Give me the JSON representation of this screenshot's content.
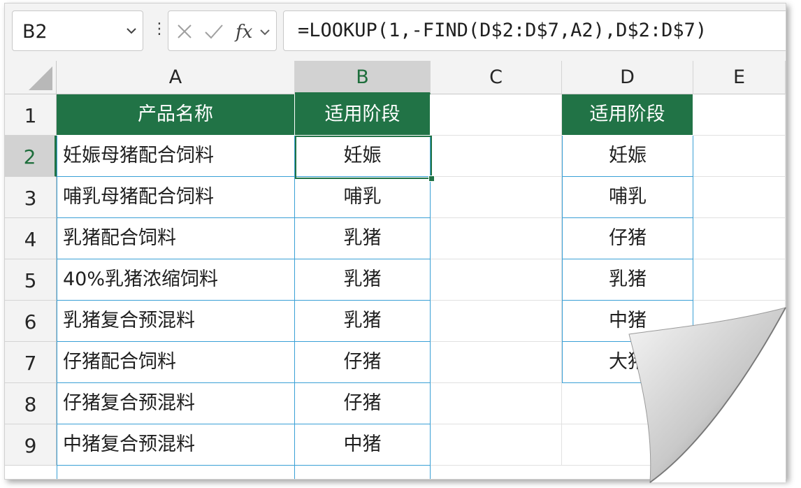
{
  "name_box": {
    "value": "B2"
  },
  "formula_bar": {
    "formula": "=LOOKUP(1,-FIND(D$2:D$7,A2),D$2:D$7)",
    "icons": [
      "cancel-icon",
      "confirm-icon",
      "fx-icon",
      "chevron-down-icon"
    ]
  },
  "columns": [
    "A",
    "B",
    "C",
    "D",
    "E"
  ],
  "rows": [
    "1",
    "2",
    "3",
    "4",
    "5",
    "6",
    "7",
    "8",
    "9"
  ],
  "selected": {
    "column": "B",
    "row": "2"
  },
  "colors": {
    "header_green": "#217346",
    "border_blue": "#3aa0d6",
    "selection_green": "#217346"
  },
  "sheet": {
    "header_a": "产品名称",
    "header_b": "适用阶段",
    "header_d": "适用阶段",
    "col_a": [
      "妊娠母猪配合饲料",
      "哺乳母猪配合饲料",
      "乳猪配合饲料",
      "40%乳猪浓缩饲料",
      "乳猪复合预混料",
      "仔猪配合饲料",
      "仔猪复合预混料",
      "中猪复合预混料"
    ],
    "col_b": [
      "妊娠",
      "哺乳",
      "乳猪",
      "乳猪",
      "乳猪",
      "仔猪",
      "仔猪",
      "中猪"
    ],
    "col_d": [
      "妊娠",
      "哺乳",
      "仔猪",
      "乳猪",
      "中猪",
      "大猪"
    ]
  }
}
